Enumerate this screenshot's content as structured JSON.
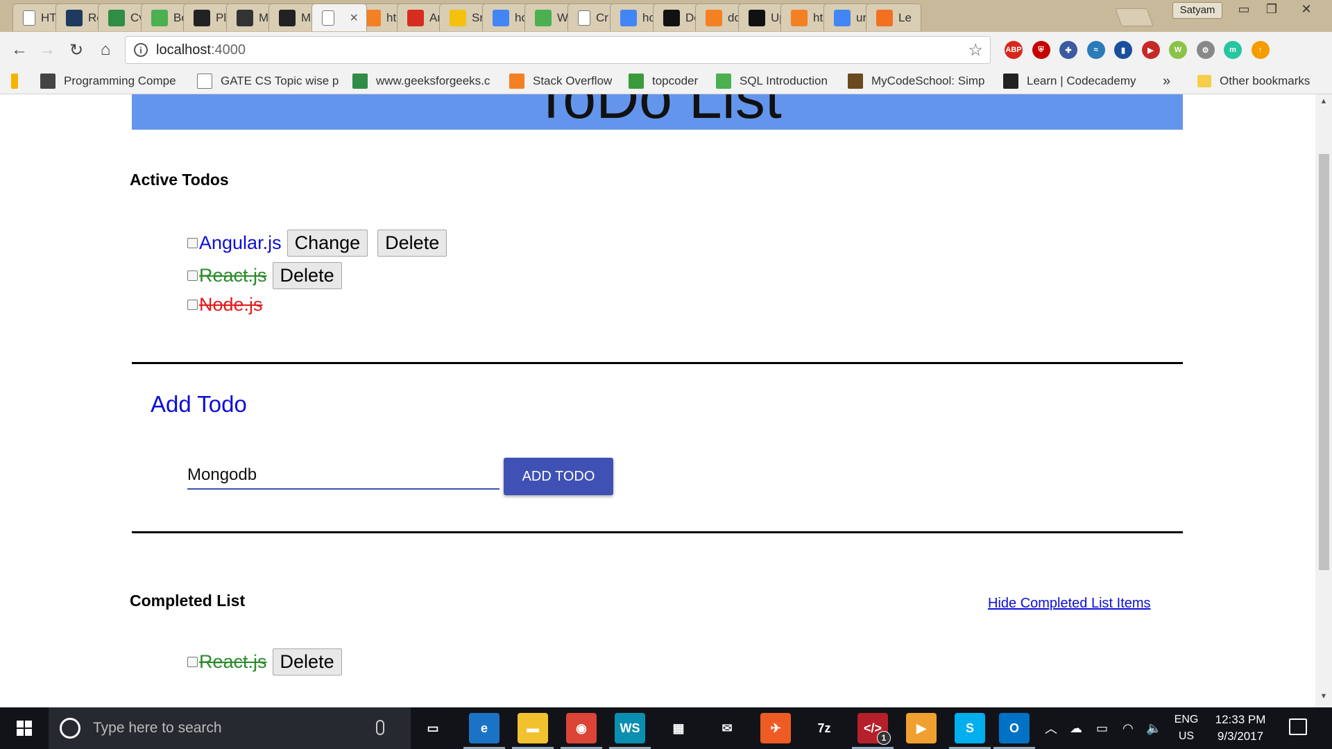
{
  "browser": {
    "tabs": [
      {
        "title": "HT",
        "icon": "page-icon",
        "color": "#ffffff"
      },
      {
        "title": "Re",
        "icon": "monitor-icon",
        "color": "#1e3a5f"
      },
      {
        "title": "Cv",
        "icon": "geeks-icon",
        "color": "#2f8d46"
      },
      {
        "title": "Bo",
        "icon": "w3-icon",
        "color": "#4caf50"
      },
      {
        "title": "Pl",
        "icon": "download-icon",
        "color": "#222222"
      },
      {
        "title": "M",
        "icon": "diamond-icon",
        "color": "#333333"
      },
      {
        "title": "M",
        "icon": "m-icon",
        "color": "#222222"
      },
      {
        "title": "",
        "icon": "page-icon",
        "color": "#ffffff",
        "active": true
      },
      {
        "title": "ht",
        "icon": "stackoverflow-icon",
        "color": "#f48024"
      },
      {
        "title": "Ar",
        "icon": "my-icon",
        "color": "#d62d20"
      },
      {
        "title": "Sr",
        "icon": "nerd-icon",
        "color": "#f4c20d"
      },
      {
        "title": "hc",
        "icon": "google-icon",
        "color": "#4285f4"
      },
      {
        "title": "W",
        "icon": "w3-icon",
        "color": "#4caf50"
      },
      {
        "title": "Cr",
        "icon": "page-icon",
        "color": "#ffffff"
      },
      {
        "title": "hc",
        "icon": "google-icon",
        "color": "#4285f4"
      },
      {
        "title": "Dc",
        "icon": "pentagon-icon",
        "color": "#111111"
      },
      {
        "title": "dc",
        "icon": "stackoverflow-icon",
        "color": "#f48024"
      },
      {
        "title": "Up",
        "icon": "github-icon",
        "color": "#111111"
      },
      {
        "title": "ht",
        "icon": "stackoverflow-icon",
        "color": "#f48024"
      },
      {
        "title": "ur",
        "icon": "google-icon",
        "color": "#4285f4"
      },
      {
        "title": "Le",
        "icon": "asterisk-icon",
        "color": "#f36f21"
      }
    ],
    "profile_name": "Satyam",
    "url_host": "localhost",
    "url_port": ":4000",
    "bookmarks": [
      {
        "label": "",
        "icon": "drive-icon"
      },
      {
        "label": "Programming Compe",
        "icon": "cc-icon"
      },
      {
        "label": "GATE CS Topic wise p",
        "icon": "page-icon"
      },
      {
        "label": "www.geeksforgeeks.c",
        "icon": "geeks-icon"
      },
      {
        "label": "Stack Overflow",
        "icon": "stackoverflow-icon"
      },
      {
        "label": "topcoder",
        "icon": "topcoder-icon"
      },
      {
        "label": "SQL Introduction",
        "icon": "w3-icon"
      },
      {
        "label": "MyCodeSchool: Simp",
        "icon": "code-icon"
      },
      {
        "label": "Learn | Codecademy",
        "icon": "codecademy-icon"
      }
    ],
    "bookmarks_overflow": "»",
    "other_bookmarks": "Other bookmarks",
    "extensions": [
      {
        "name": "adblock-plus-icon",
        "label": "ABP",
        "color": "#d7261b"
      },
      {
        "name": "ublock-icon",
        "label": "⛨",
        "color": "#c70000"
      },
      {
        "name": "puzzle-icon",
        "label": "✚",
        "color": "#3a5ba0"
      },
      {
        "name": "wave-icon",
        "label": "≈",
        "color": "#2b7bb9"
      },
      {
        "name": "bookmark-ext-icon",
        "label": "▮",
        "color": "#1a4f9c"
      },
      {
        "name": "playlist-icon",
        "label": "▶",
        "color": "#c62828"
      },
      {
        "name": "w-circle-icon",
        "label": "W",
        "color": "#8bc34a"
      },
      {
        "name": "settings-ext-icon",
        "label": "⚙",
        "color": "#888888"
      },
      {
        "name": "m-circle-icon",
        "label": "m",
        "color": "#26c6a0"
      },
      {
        "name": "upload-circle-icon",
        "label": "↑",
        "color": "#f59c00"
      }
    ]
  },
  "page": {
    "title": "ToDo List",
    "active_heading": "Active Todos",
    "active_todos": [
      {
        "text": "Angular.js",
        "style": "blue",
        "buttons": [
          "Change",
          "Delete"
        ]
      },
      {
        "text": "React.js",
        "style": "green",
        "buttons": [
          "Delete"
        ]
      },
      {
        "text": "Node.js",
        "style": "red",
        "buttons": []
      }
    ],
    "add_heading": "Add Todo",
    "input_value": "Mongodb",
    "add_button": "ADD TODO",
    "completed_heading": "Completed List",
    "hide_link": "Hide Completed List Items",
    "completed_todos": [
      {
        "text": "React.js",
        "style": "green",
        "buttons": [
          "Delete"
        ]
      }
    ]
  },
  "taskbar": {
    "search_placeholder": "Type here to search",
    "apps": [
      {
        "name": "task-view-icon",
        "label": "▭",
        "color": "#111318"
      },
      {
        "name": "edge-icon",
        "label": "e",
        "color": "#1b73c6"
      },
      {
        "name": "file-explorer-icon",
        "label": "▬",
        "color": "#f2c12e"
      },
      {
        "name": "chrome-icon",
        "label": "◉",
        "color": "#db4437"
      },
      {
        "name": "webstorm-icon",
        "label": "WS",
        "color": "#0b8fb0"
      },
      {
        "name": "store-icon",
        "label": "▦",
        "color": "#111318"
      },
      {
        "name": "mail-icon",
        "label": "✉",
        "color": "#111318"
      },
      {
        "name": "postman-icon",
        "label": "✈",
        "color": "#ef5b25"
      },
      {
        "name": "7zip-icon",
        "label": "7z",
        "color": "#111318"
      },
      {
        "name": "code-editor-icon",
        "label": "</>",
        "color": "#b5202a"
      },
      {
        "name": "media-player-icon",
        "label": "▶",
        "color": "#f0a030"
      },
      {
        "name": "skype-icon",
        "label": "S",
        "color": "#00aff0"
      },
      {
        "name": "outlook-icon",
        "label": "O",
        "color": "#0072c6"
      }
    ],
    "editor_badge": "1",
    "language": "ENG",
    "region": "US",
    "time": "12:33 PM",
    "date": "9/3/2017"
  }
}
